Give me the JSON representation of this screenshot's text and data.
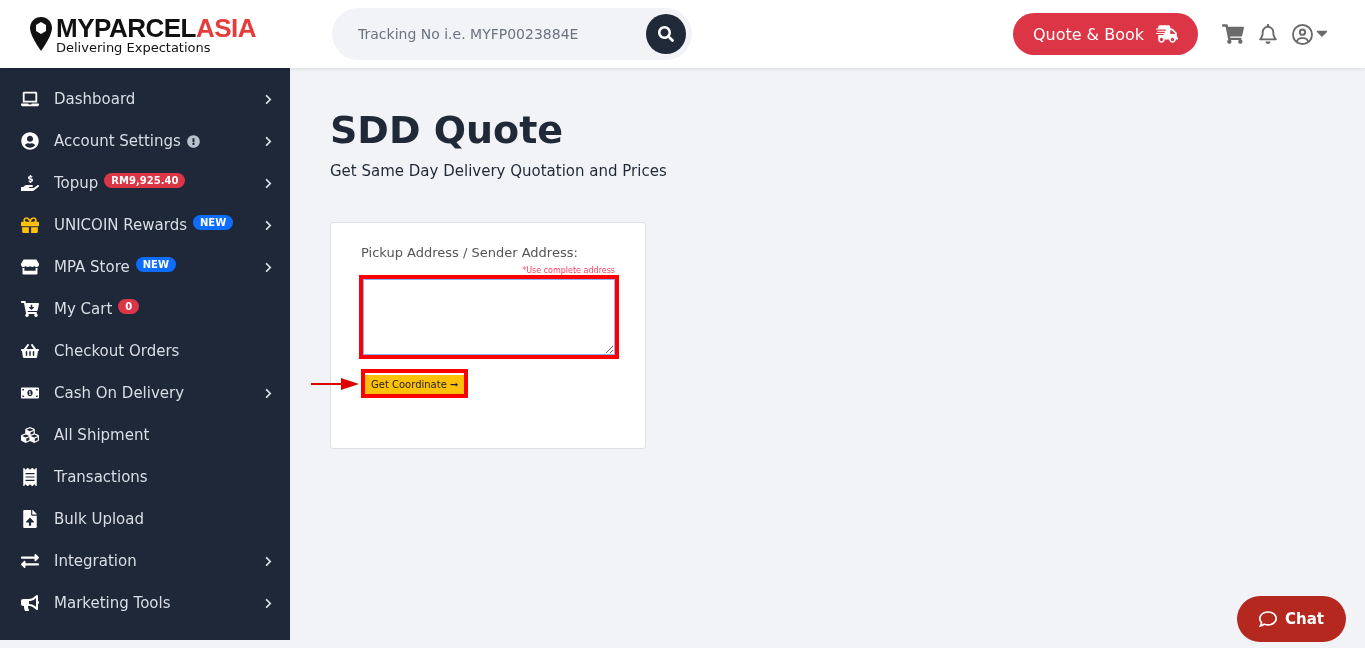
{
  "header": {
    "logo": {
      "brand_dark": "MYPARCEL",
      "brand_accent": "ASIA",
      "tagline": "Delivering Expectations"
    },
    "search": {
      "placeholder": "Tracking No i.e. MYFP0023884E"
    },
    "quote_button": "Quote & Book"
  },
  "sidebar": {
    "items": [
      {
        "label": "Dashboard",
        "submenu": true
      },
      {
        "label": "Account Settings",
        "submenu": true,
        "badge": {
          "kind": "info"
        }
      },
      {
        "label": "Topup",
        "submenu": true,
        "badge": {
          "kind": "text",
          "text": "RM9,925.40",
          "color": "#dc3545"
        }
      },
      {
        "label": "UNICOIN Rewards",
        "submenu": true,
        "badge": {
          "kind": "text",
          "text": "NEW",
          "color": "#0d6efd"
        }
      },
      {
        "label": "MPA Store",
        "submenu": true,
        "badge": {
          "kind": "text",
          "text": "NEW",
          "color": "#0d6efd"
        }
      },
      {
        "label": "My Cart",
        "submenu": false,
        "badge": {
          "kind": "text",
          "text": "0",
          "color": "#dc3545"
        }
      },
      {
        "label": "Checkout Orders",
        "submenu": false
      },
      {
        "label": "Cash On Delivery",
        "submenu": true
      },
      {
        "label": "All Shipment",
        "submenu": false
      },
      {
        "label": "Transactions",
        "submenu": false
      },
      {
        "label": "Bulk Upload",
        "submenu": false
      },
      {
        "label": "Integration",
        "submenu": true
      },
      {
        "label": "Marketing Tools",
        "submenu": true
      }
    ]
  },
  "main": {
    "title": "SDD Quote",
    "subtitle": "Get Same Day Delivery Quotation and Prices",
    "form": {
      "label": "Pickup Address / Sender Address:",
      "hint": "*Use complete address",
      "address": {
        "highlighted": true
      },
      "coordinate_button": {
        "label": "Get Coordinate ➞",
        "highlighted": true
      }
    }
  },
  "chat_button": "Chat"
}
